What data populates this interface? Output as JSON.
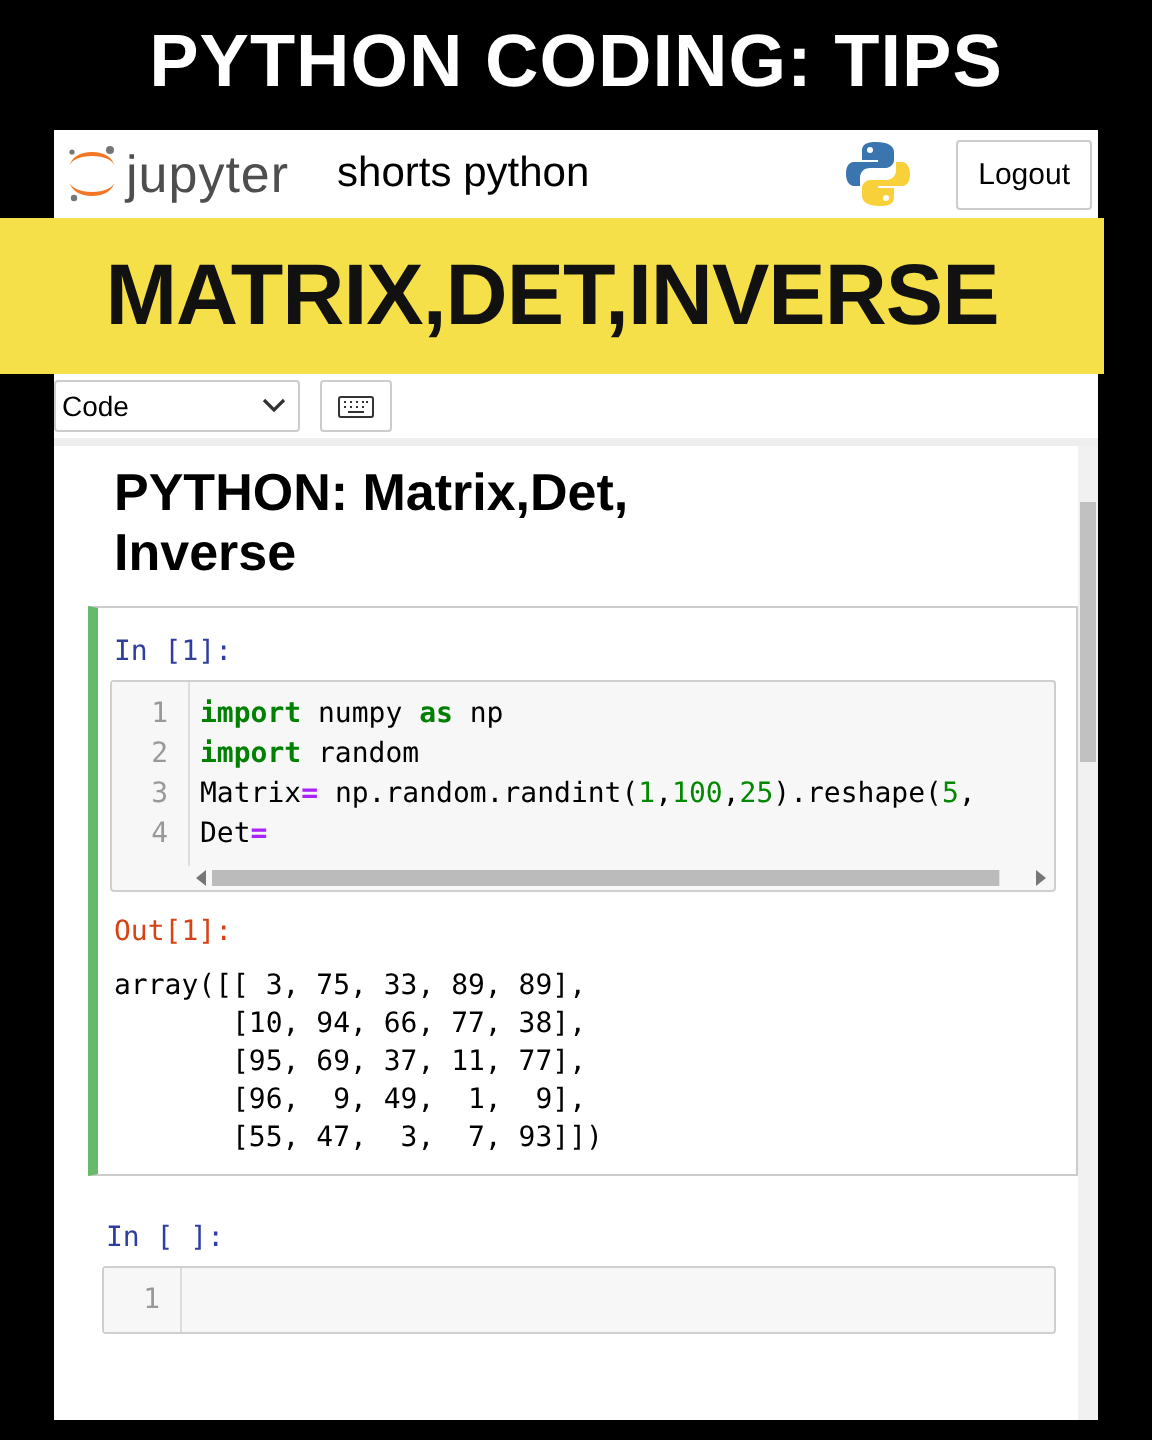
{
  "video_title": "PYTHON CODING: TIPS",
  "header": {
    "logo_text": "jupyter",
    "notebook_name": "shorts python",
    "logout": "Logout"
  },
  "banner": "MATRIX,DET,INVERSE",
  "toolbar": {
    "cell_type": "Code"
  },
  "heading": "PYTHON: Matrix,Det, Inverse",
  "cells": [
    {
      "kind": "run",
      "prompt": "In [1]:",
      "lines": [
        {
          "number": "1",
          "tokens": [
            {
              "kind": "keyword",
              "text": "import"
            },
            {
              "kind": "plain",
              "text": " numpy "
            },
            {
              "kind": "keyword",
              "text": "as"
            },
            {
              "kind": "plain",
              "text": " np"
            }
          ]
        },
        {
          "number": "2",
          "tokens": [
            {
              "kind": "keyword",
              "text": "import"
            },
            {
              "kind": "plain",
              "text": " random"
            }
          ]
        },
        {
          "number": "3",
          "tokens": [
            {
              "kind": "plain",
              "text": "Matrix"
            },
            {
              "kind": "operator",
              "text": "="
            },
            {
              "kind": "plain",
              "text": " np.random.randint("
            },
            {
              "kind": "number",
              "text": "1"
            },
            {
              "kind": "plain",
              "text": ","
            },
            {
              "kind": "number",
              "text": "100"
            },
            {
              "kind": "plain",
              "text": ","
            },
            {
              "kind": "number",
              "text": "25"
            },
            {
              "kind": "plain",
              "text": ").reshape("
            },
            {
              "kind": "number",
              "text": "5"
            },
            {
              "kind": "plain",
              "text": ","
            }
          ]
        },
        {
          "number": "4",
          "tokens": [
            {
              "kind": "plain",
              "text": "Det"
            },
            {
              "kind": "operator",
              "text": "="
            }
          ]
        }
      ],
      "out_prompt": "Out[1]:",
      "output": [
        "array([[ 3, 75, 33, 89, 89],",
        "       [10, 94, 66, 77, 38],",
        "       [95, 69, 37, 11, 77],",
        "       [96,  9, 49,  1,  9],",
        "       [55, 47,  3,  7, 93]])"
      ]
    },
    {
      "kind": "empty",
      "prompt": "In [ ]:",
      "lines": [
        {
          "number": "1"
        }
      ]
    }
  ]
}
